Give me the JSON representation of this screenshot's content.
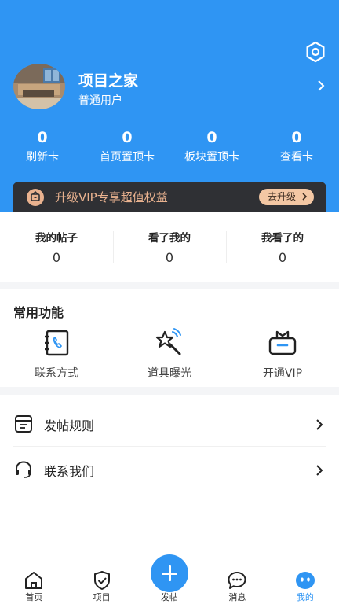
{
  "profile": {
    "name": "项目之家",
    "user_type": "普通用户"
  },
  "stats": [
    {
      "value": "0",
      "label": "刷新卡"
    },
    {
      "value": "0",
      "label": "首页置顶卡"
    },
    {
      "value": "0",
      "label": "板块置顶卡"
    },
    {
      "value": "0",
      "label": "查看卡"
    }
  ],
  "vip_banner": {
    "text": "升级VIP专享超值权益",
    "button": "去升级"
  },
  "posts": [
    {
      "label": "我的帖子",
      "value": "0"
    },
    {
      "label": "看了我的",
      "value": "0"
    },
    {
      "label": "我看了的",
      "value": "0"
    }
  ],
  "functions": {
    "title": "常用功能",
    "items": [
      {
        "label": "联系方式",
        "icon": "contact-book-icon"
      },
      {
        "label": "道具曝光",
        "icon": "magic-wand-icon"
      },
      {
        "label": "开通VIP",
        "icon": "vip-gift-icon"
      }
    ]
  },
  "menu": [
    {
      "label": "发帖规则",
      "icon": "document-icon"
    },
    {
      "label": "联系我们",
      "icon": "headset-icon"
    }
  ],
  "tabs": [
    {
      "label": "首页",
      "icon": "home-icon"
    },
    {
      "label": "项目",
      "icon": "shield-check-icon"
    },
    {
      "label": "发帖",
      "icon": "plus-icon"
    },
    {
      "label": "消息",
      "icon": "chat-icon"
    },
    {
      "label": "我的",
      "icon": "profile-bubble-icon",
      "active": true
    }
  ],
  "colors": {
    "primary": "#2f95f3",
    "vip_dark": "#2f3034",
    "vip_gold": "#e9b28f"
  }
}
